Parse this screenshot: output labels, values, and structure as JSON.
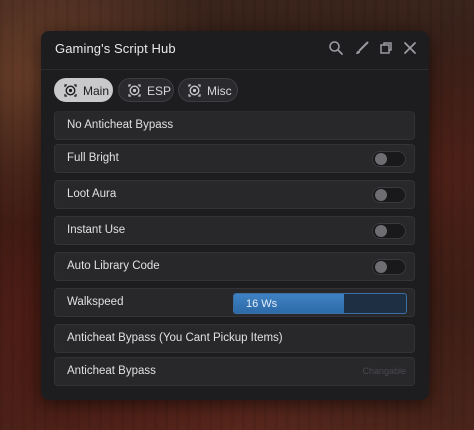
{
  "window": {
    "title": "Gaming's Script Hub"
  },
  "titlebar_icons": [
    "search-icon",
    "brush-icon",
    "minimize-icon",
    "close-icon"
  ],
  "tabs": [
    {
      "label": "Main",
      "icon": "target-icon",
      "active": true
    },
    {
      "label": "ESP",
      "icon": "target-icon",
      "active": false
    },
    {
      "label": "Misc",
      "icon": "target-icon",
      "active": false
    }
  ],
  "rows": {
    "no_anticheat": {
      "label": "No Anticheat Bypass"
    },
    "full_bright": {
      "label": "Full Bright",
      "enabled": false
    },
    "loot_aura": {
      "label": "Loot Aura",
      "enabled": false
    },
    "instant_use": {
      "label": "Instant Use",
      "enabled": false
    },
    "auto_library": {
      "label": "Auto Library Code",
      "enabled": false
    },
    "walkspeed": {
      "label": "Walkspeed",
      "value_text": "16 Ws",
      "fill_fraction": 0.64
    },
    "anticheat_pickup": {
      "label": "Anticheat Bypass (You Cant Pickup Items)"
    },
    "anticheat_bypass": {
      "label": "Anticheat Bypass",
      "hint": "Changable"
    }
  },
  "colors": {
    "accent": "#3f82c4",
    "panel": "#1d1d20",
    "active_tab": "#c9c9cc"
  }
}
